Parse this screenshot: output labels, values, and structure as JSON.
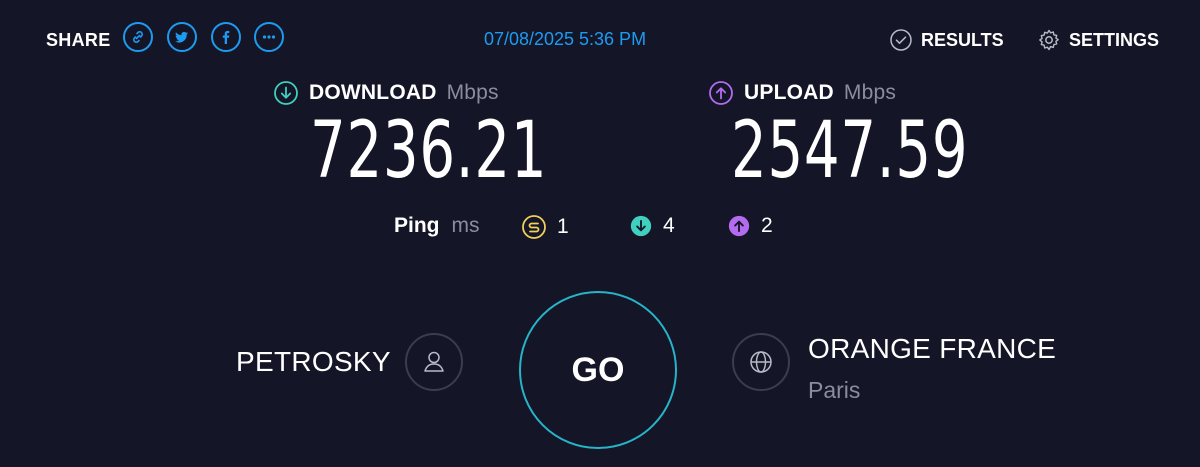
{
  "header": {
    "share_label": "SHARE",
    "share_buttons": [
      "link-icon",
      "twitter-icon",
      "facebook-icon",
      "more-icon"
    ],
    "timestamp": "07/08/2025 5:36 PM",
    "results_label": "RESULTS",
    "settings_label": "SETTINGS"
  },
  "download": {
    "label": "DOWNLOAD",
    "unit": "Mbps",
    "value": "7236.21",
    "color": "#3fd0c0"
  },
  "upload": {
    "label": "UPLOAD",
    "unit": "Mbps",
    "value": "2547.59",
    "color": "#b36cf0"
  },
  "ping": {
    "label": "Ping",
    "unit": "ms",
    "idle": "1",
    "download": "4",
    "upload": "2",
    "idle_color": "#f0d05a"
  },
  "go_label": "GO",
  "host": {
    "name": "PETROSKY"
  },
  "isp": {
    "name": "ORANGE FRANCE",
    "city": "Paris"
  },
  "colors": {
    "background": "#141526",
    "accent": "#1d9bf0",
    "ring": "#27b3c8"
  }
}
